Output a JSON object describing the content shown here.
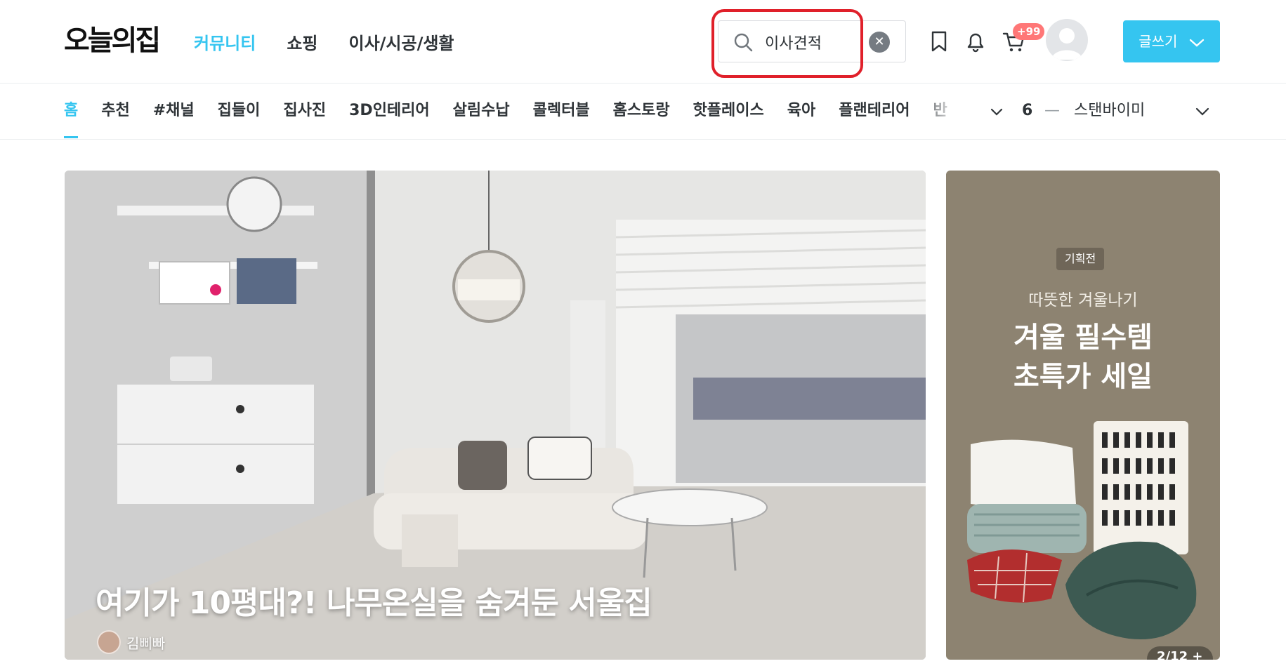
{
  "header": {
    "logo": "오늘의집",
    "nav": [
      {
        "label": "커뮤니티",
        "active": true
      },
      {
        "label": "쇼핑",
        "active": false
      },
      {
        "label": "이사/시공/생활",
        "active": false
      }
    ],
    "search": {
      "value": "이사견적",
      "clear_icon": "close-icon"
    },
    "icons": [
      "bookmark-icon",
      "bell-icon",
      "cart-icon"
    ],
    "cart_badge": "+99",
    "write_button": "글쓰기"
  },
  "sub_nav": {
    "items": [
      {
        "label": "홈",
        "active": true
      },
      {
        "label": "추천",
        "active": false
      },
      {
        "label": "#채널",
        "active": false
      },
      {
        "label": "집들이",
        "active": false
      },
      {
        "label": "집사진",
        "active": false
      },
      {
        "label": "3D인테리어",
        "active": false
      },
      {
        "label": "살림수납",
        "active": false
      },
      {
        "label": "콜렉터블",
        "active": false
      },
      {
        "label": "홈스토랑",
        "active": false
      },
      {
        "label": "핫플레이스",
        "active": false
      },
      {
        "label": "육아",
        "active": false
      },
      {
        "label": "플랜테리어",
        "active": false
      },
      {
        "label": "반",
        "active": false
      }
    ],
    "ranking": {
      "number": "6",
      "dash": "—",
      "term": "스탠바이미"
    }
  },
  "hero": {
    "title": "여기가 10평대?! 나무온실을 숨겨둔 서울집",
    "author": "김삐빠"
  },
  "promo": {
    "tag": "기획전",
    "subtitle": "따뜻한 겨울나기",
    "title": "겨울 필수템\n초특가 세일",
    "page": "2/12 +"
  },
  "colors": {
    "accent": "#35c5f0",
    "highlight": "#e0202a",
    "badge": "#ff7777",
    "promo_bg": "#8d8371"
  }
}
